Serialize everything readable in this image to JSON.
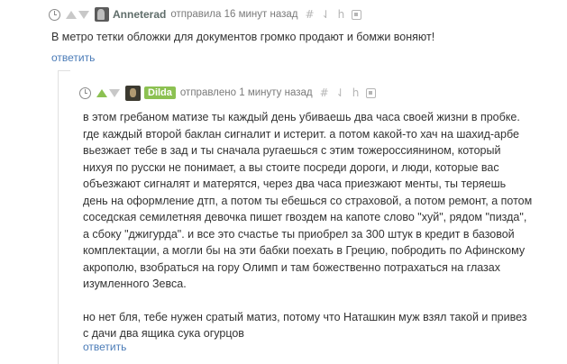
{
  "comment1": {
    "author": "Anneterad",
    "action": "отправила 16 минут назад",
    "icon_hash": "#",
    "icon_bookmark": "⇃",
    "icon_h": "h",
    "text": "В метро тетки обложки для документов громко продают и бомжи воняют!",
    "reply": "ответить"
  },
  "comment2": {
    "author": "Dilda",
    "action": "отправлено 1 минуту назад",
    "icon_hash": "#",
    "icon_bookmark": "⇃",
    "icon_h": "h",
    "lines": [
      "в этом гребаном матизе ты каждый день убиваешь два часа своей жизни в пробке.",
      "где каждый второй баклан сигналит и истерит. а потом какой-то хач на шахид-арбе",
      "вьезжает тебе в зад и ты сначала ругаешься с этим тожероссиянином, который",
      "нихуя по русски не понимает, а вы стоите посреди дороги, и люди, которые вас",
      "объезжают сигналят и матерятся, через два часа приезжают менты, ты теряешь",
      "день на оформление дтп, а потом ты ебешься со страховой, а потом ремонт, а потом",
      "соседская семилетняя девочка пишет гвоздем на капоте слово \"хуй\", рядом \"пизда\",",
      "а сбоку \"джигурда\". и все это счастье ты приобрел за 300 штук в кредит в базовой",
      "комплектации, а могли бы на эти бабки поехать в Грецию, побродить по Афинскому",
      "акрополю, взобраться на гору Олимп и там божественно потрахаться на глазах",
      "изумленного Зевса."
    ],
    "lines2": [
      "но нет бля, тебе нужен сратый матиз, потому что Наташкин муж взял такой и привез",
      "с дачи два ящика сука огурцов"
    ],
    "reply": "ответить"
  }
}
